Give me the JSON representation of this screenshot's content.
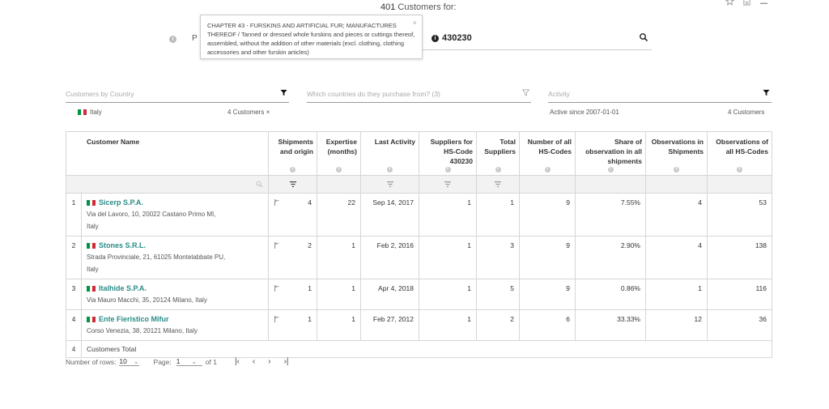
{
  "header": {
    "count": "401",
    "title_suffix": " Customers for:",
    "product_prefix": "P",
    "hs_code": "430230",
    "icons": [
      "star-icon",
      "document-icon",
      "menu-icon"
    ]
  },
  "tooltip": {
    "text": "CHAPTER 43 - FURSKINS AND ARTIFICIAL FUR; MANUFACTURES THEREOF / Tanned or dressed whole furskins and pieces or cuttings thereof, assembled, without the addition of other materials (excl. clothing, clothing accessories and other furskin articles)",
    "close": "×"
  },
  "filters": {
    "country": {
      "placeholder": "Customers by Country",
      "selected": "Italy",
      "count": "4 Customers ×"
    },
    "purchase": {
      "placeholder": "Which countries do they purchase from? (3)"
    },
    "activity": {
      "placeholder": "Activity",
      "selected": "Active since 2007-01-01",
      "count": "4 Customers"
    }
  },
  "table": {
    "headers": {
      "name": "Customer Name",
      "shipments": "Shipments and origin",
      "expertise": "Expertise (months)",
      "last_activity": "Last Activity",
      "suppliers_hs": "Suppliers for HS-Code 430230",
      "total_suppliers": "Total Suppliers",
      "num_hs": "Number of all HS-Codes",
      "share": "Share of observation in all shipments",
      "obs_ship": "Observations in Shipments",
      "obs_all": "Observations of all HS-Codes"
    },
    "rows": [
      {
        "idx": "1",
        "name": "Sicerp S.P.A.",
        "addr1": "Via del Lavoro, 10, 20022 Castano Primo MI,",
        "addr2": "Italy",
        "shipments": "4",
        "expertise": "22",
        "last": "Sep 14, 2017",
        "sup_hs": "1",
        "total_sup": "1",
        "num_hs": "9",
        "share": "7.55%",
        "obs_ship": "4",
        "obs_all": "53"
      },
      {
        "idx": "2",
        "name": "Stones S.R.L.",
        "addr1": "Strada Provinciale, 21, 61025 Montelabbate PU,",
        "addr2": "Italy",
        "shipments": "2",
        "expertise": "1",
        "last": "Feb 2, 2016",
        "sup_hs": "1",
        "total_sup": "3",
        "num_hs": "9",
        "share": "2.90%",
        "obs_ship": "4",
        "obs_all": "138"
      },
      {
        "idx": "3",
        "name": "Italhide S.P.A.",
        "addr1": "Via Mauro Macchi, 35, 20124 Milano, Italy",
        "addr2": "",
        "shipments": "1",
        "expertise": "1",
        "last": "Apr 4, 2018",
        "sup_hs": "1",
        "total_sup": "5",
        "num_hs": "9",
        "share": "0.86%",
        "obs_ship": "1",
        "obs_all": "116"
      },
      {
        "idx": "4",
        "name": "Ente Fieristico Mifur",
        "addr1": "Corso Venezia, 38, 20121 Milano, Italy",
        "addr2": "",
        "shipments": "1",
        "expertise": "1",
        "last": "Feb 27, 2012",
        "sup_hs": "1",
        "total_sup": "2",
        "num_hs": "6",
        "share": "33.33%",
        "obs_ship": "12",
        "obs_all": "36"
      }
    ],
    "footer": {
      "count": "4",
      "label": "Customers Total"
    }
  },
  "pager": {
    "rows_label": "Number of rows:",
    "rows_value": "10",
    "page_label": "Page:",
    "page_value": "1",
    "of_label": "of 1"
  }
}
